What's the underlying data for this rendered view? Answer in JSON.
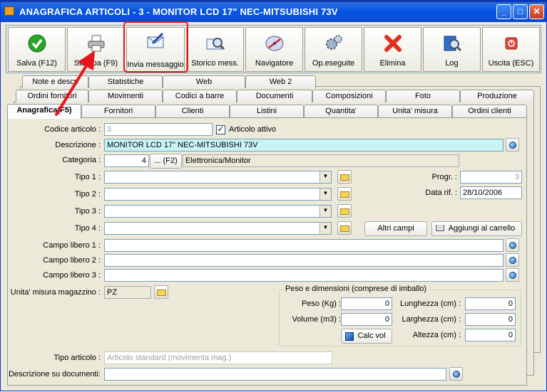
{
  "window": {
    "title": "ANAGRAFICA ARTICOLI - 3 - MONITOR LCD 17\" NEC-MITSUBISHI 73V",
    "minimize": "_",
    "maximize": "□",
    "close": "✕"
  },
  "toolbar": {
    "buttons": [
      {
        "label": "Salva (F12)",
        "icon": "check-icon"
      },
      {
        "label": "Stampa (F9)",
        "icon": "printer-icon"
      },
      {
        "label": "Invia messaggio",
        "icon": "envelope-pen-icon"
      },
      {
        "label": "Storico mess.",
        "icon": "envelope-magnifier-icon"
      },
      {
        "label": "Navigatore",
        "icon": "compass-icon"
      },
      {
        "label": "Op.eseguite",
        "icon": "gears-icon"
      },
      {
        "label": "Elimina",
        "icon": "red-x-icon"
      },
      {
        "label": "Log",
        "icon": "log-magnifier-icon"
      },
      {
        "label": "Uscita (ESC)",
        "icon": "power-icon"
      }
    ]
  },
  "tabs": {
    "row1": [
      "Note e descr.",
      "Statistiche",
      "Web",
      "Web 2"
    ],
    "row2": [
      "Ordini fornitori",
      "Movimenti",
      "Codici a barre",
      "Documenti",
      "Composizioni",
      "Foto",
      "Produzione"
    ],
    "row3": [
      "Anagrafica(F5)",
      "Fornitori",
      "Clienti",
      "Listini",
      "Quantita'",
      "Unita' misura",
      "Ordini clienti"
    ]
  },
  "form": {
    "codice_label": "Codice articolo :",
    "codice_value": "3",
    "attivo_label": "Articolo attivo",
    "attivo_checked": "✓",
    "descrizione_label": "Descrizione :",
    "descrizione_value": "MONITOR LCD 17\" NEC-MITSUBISHI 73V",
    "categoria_label": "Categoria :",
    "categoria_value": "4",
    "categoria_btn": "... (F2)",
    "categoria_desc": "Elettronica/Monitor",
    "tipo1_label": "Tipo 1 :",
    "tipo2_label": "Tipo 2 :",
    "tipo3_label": "Tipo 3 :",
    "tipo4_label": "Tipo 4 :",
    "progr_label": "Progr. :",
    "progr_value": "3",
    "datarif_label": "Data rif. :",
    "datarif_value": "28/10/2006",
    "altri_campi": "Altri campi",
    "aggiungi_carrello": "Aggiungi al carrello",
    "campo1_label": "Campo libero 1 :",
    "campo2_label": "Campo libero 2 :",
    "campo3_label": "Campo libero 3 :",
    "um_label": "Unita' misura magazzino :",
    "um_value": "PZ",
    "peso_group": "Peso e dimensioni (comprese di imballo)",
    "peso_label": "Peso (Kg) :",
    "peso_value": "0",
    "volume_label": "Volume (m3) :",
    "volume_value": "0",
    "lunghezza_label": "Lunghezza (cm) :",
    "lunghezza_value": "0",
    "larghezza_label": "Larghezza (cm) :",
    "larghezza_value": "0",
    "altezza_label": "Altezza (cm) :",
    "altezza_value": "0",
    "calc_vol": "Calc vol",
    "tipo_articolo_label": "Tipo articolo :",
    "tipo_articolo_value": "Articolo standard (movimenta mag.)",
    "desc_doc_label": "Descrizione su documenti:"
  },
  "colors": {
    "highlight": "#e8151b",
    "description_bg": "#c8f4f6",
    "title_bar": "#0554e3"
  }
}
